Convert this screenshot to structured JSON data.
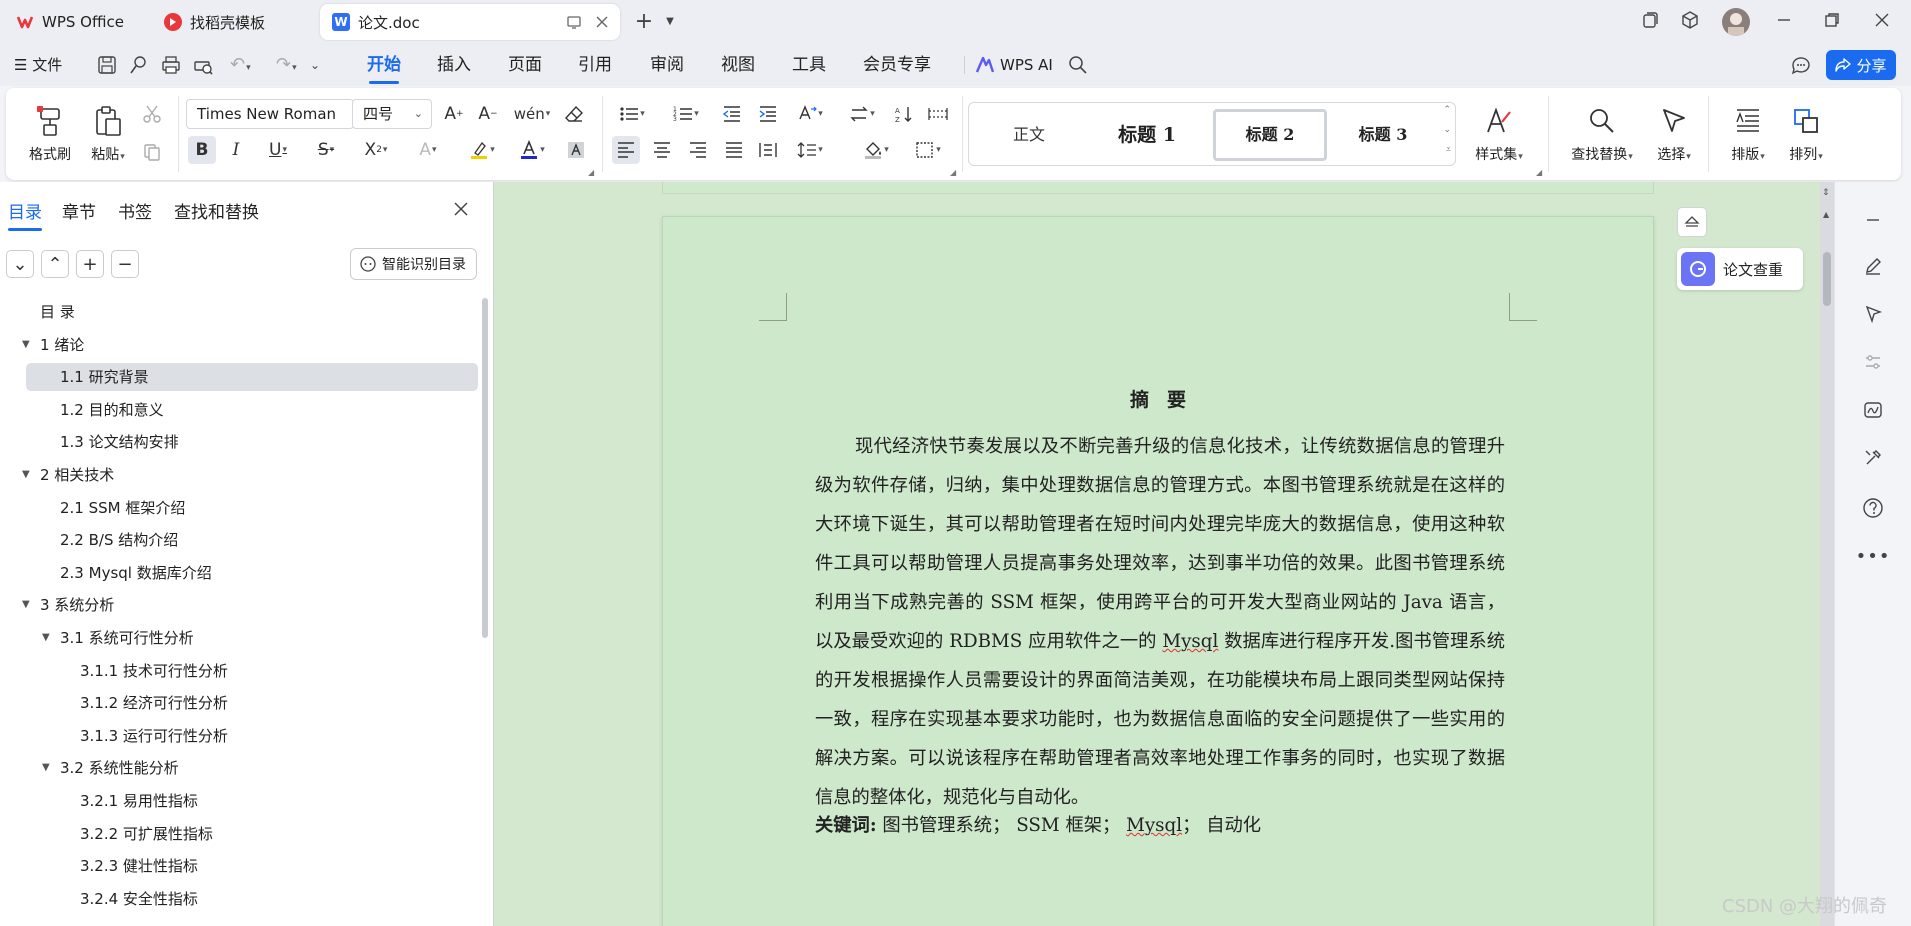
{
  "tabs": [
    {
      "label": "WPS Office",
      "icon": "wps-logo-icon"
    },
    {
      "label": "找稻壳模板",
      "icon": "docer-icon"
    },
    {
      "label": "论文.doc",
      "icon": "word-doc-icon"
    }
  ],
  "menu": {
    "file": "文件",
    "items": [
      "开始",
      "插入",
      "页面",
      "引用",
      "审阅",
      "视图",
      "工具",
      "会员专享"
    ],
    "active": "开始",
    "wps_ai": "WPS AI",
    "share": "分享"
  },
  "ribbon": {
    "format_painter": "格式刷",
    "paste": "粘贴",
    "font_name": "Times New Roman",
    "font_size": "四号",
    "styles": [
      "正文",
      "标题 1",
      "标题 2",
      "标题 3"
    ],
    "selected_style": "标题 2",
    "style_set": "样式集",
    "find_replace": "查找替换",
    "select": "选择",
    "layout": "排版",
    "arrange": "排列"
  },
  "sidebar": {
    "tabs": [
      "目录",
      "章节",
      "书签",
      "查找和替换"
    ],
    "active_tab": "目录",
    "smart_toc": "智能识别目录",
    "toc": [
      {
        "label": "目  录",
        "level": 1,
        "arrow": ""
      },
      {
        "label": "1  绪论",
        "level": 1,
        "arrow": "down"
      },
      {
        "label": "1.1  研究背景",
        "level": 2,
        "arrow": "",
        "selected": true
      },
      {
        "label": "1.2  目的和意义",
        "level": 2,
        "arrow": ""
      },
      {
        "label": "1.3  论文结构安排",
        "level": 2,
        "arrow": ""
      },
      {
        "label": "2  相关技术",
        "level": 1,
        "arrow": "down"
      },
      {
        "label": "2.1 SSM 框架介绍",
        "level": 2,
        "arrow": ""
      },
      {
        "label": "2.2 B/S 结构介绍",
        "level": 2,
        "arrow": ""
      },
      {
        "label": "2.3 Mysql 数据库介绍",
        "level": 2,
        "arrow": ""
      },
      {
        "label": "3  系统分析",
        "level": 1,
        "arrow": "down"
      },
      {
        "label": "3.1  系统可行性分析",
        "level": 2,
        "arrow": "down"
      },
      {
        "label": "3.1.1  技术可行性分析",
        "level": 3,
        "arrow": ""
      },
      {
        "label": "3.1.2  经济可行性分析",
        "level": 3,
        "arrow": ""
      },
      {
        "label": "3.1.3  运行可行性分析",
        "level": 3,
        "arrow": ""
      },
      {
        "label": "3.2  系统性能分析",
        "level": 2,
        "arrow": "down"
      },
      {
        "label": "3.2.1  易用性指标",
        "level": 3,
        "arrow": ""
      },
      {
        "label": "3.2.2  可扩展性指标",
        "level": 3,
        "arrow": ""
      },
      {
        "label": "3.2.3  健壮性指标",
        "level": 3,
        "arrow": ""
      },
      {
        "label": "3.2.4  安全性指标",
        "level": 3,
        "arrow": ""
      }
    ]
  },
  "document": {
    "title": "摘要",
    "abstract": "现代经济快节奏发展以及不断完善升级的信息化技术，让传统数据信息的管理升级为软件存储，归纳，集中处理数据信息的管理方式。本图书管理系统就是在这样的大环境下诞生，其可以帮助管理者在短时间内处理完毕庞大的数据信息，使用这种软件工具可以帮助管理人员提高事务处理效率，达到事半功倍的效果。此图书管理系统利用当下成熟完善的 SSM 框架，使用跨平台的可开发大型商业网站的 Java 语言，以及最受欢迎的 RDBMS 应用软件之一的 Mysql 数据库进行程序开发.图书管理系统的开发根据操作人员需要设计的界面简洁美观，在功能模块布局上跟同类型网站保持一致，程序在实现基本要求功能时，也为数据信息面临的安全问题提供了一些实用的解决方案。可以说该程序在帮助管理者高效率地处理工作事务的同时，也实现了数据信息的整体化，规范化与自动化。",
    "keywords_label": "关键词:",
    "keywords": [
      "图书管理系统",
      "SSM 框架",
      "Mysql",
      "自动化"
    ]
  },
  "floating": {
    "paper_check": "论文查重"
  },
  "watermark": "CSDN @大翔的佩奇"
}
